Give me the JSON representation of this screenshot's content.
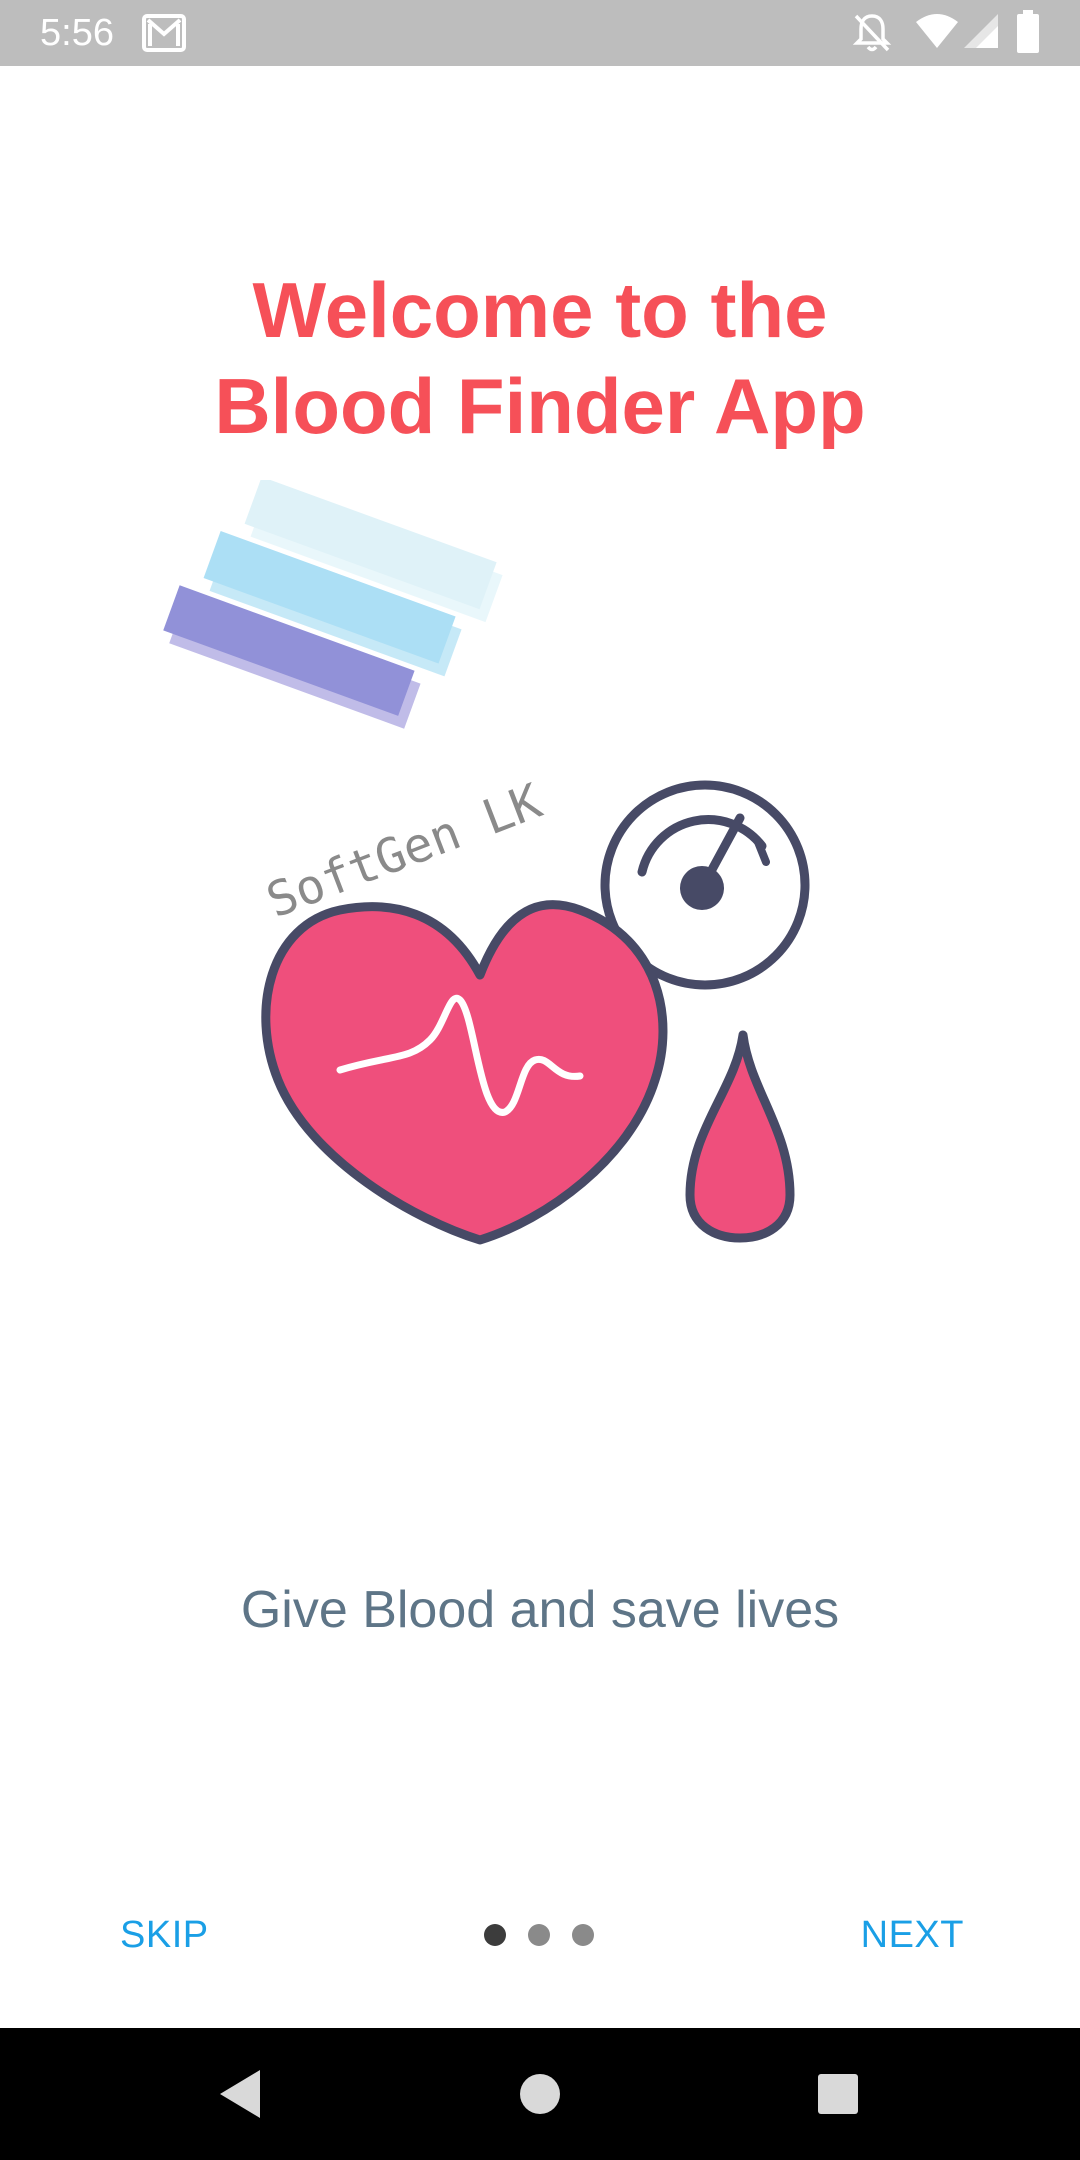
{
  "status_bar": {
    "time": "5:56",
    "icons": [
      "gmail-icon",
      "notifications-off-icon",
      "wifi-icon",
      "signal-icon",
      "battery-icon"
    ]
  },
  "onboarding": {
    "title_line1": "Welcome to the",
    "title_line2": "Blood Finder App",
    "illustration_watermark": "SoftGen LK",
    "subtitle": "Give Blood and save lives",
    "skip_label": "SKIP",
    "next_label": "NEXT",
    "page_index": 1,
    "page_count": 3
  },
  "colors": {
    "title": "#f65058",
    "subtitle": "#5e7587",
    "accent": "#1a9fe6",
    "heart": "#ef4f7c",
    "outline": "#474a66"
  },
  "nav_bar": {
    "icons": [
      "back-icon",
      "home-icon",
      "recents-icon"
    ]
  }
}
